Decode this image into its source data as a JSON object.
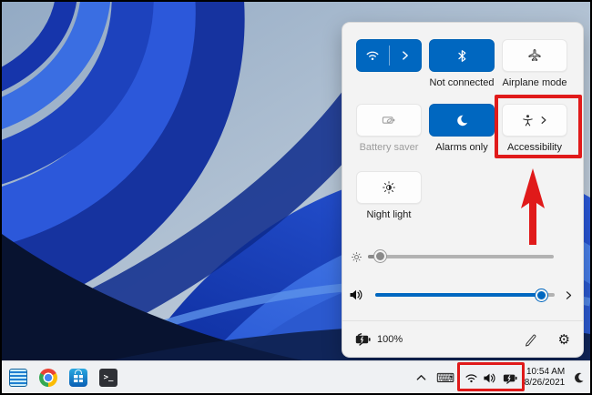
{
  "colors": {
    "accent_blue": "#0067c0",
    "annotation_red": "#e01a1a",
    "panel_bg": "#f3f3f3",
    "taskbar_bg": "#eff1f3"
  },
  "quick_settings": {
    "tiles": [
      {
        "name": "wifi",
        "label": "",
        "state": "on"
      },
      {
        "name": "bluetooth",
        "label": "Not connected",
        "state": "on"
      },
      {
        "name": "airplane-mode",
        "label": "Airplane mode",
        "state": "off"
      },
      {
        "name": "battery-saver",
        "label": "Battery saver",
        "state": "disabled"
      },
      {
        "name": "focus-assist",
        "label": "Alarms only",
        "state": "on"
      },
      {
        "name": "accessibility",
        "label": "Accessibility",
        "state": "off"
      },
      {
        "name": "night-light",
        "label": "Night light",
        "state": "off"
      }
    ],
    "sliders": {
      "brightness": {
        "percent": 7
      },
      "volume": {
        "percent": 93
      }
    },
    "battery_percent": "100%"
  },
  "taskbar": {
    "apps": [
      "notes-app",
      "chrome",
      "microsoft-store",
      "terminal"
    ],
    "terminal_glyph": ">_"
  },
  "tray": {
    "time": "10:54 AM",
    "date": "8/26/2021",
    "keyboard_glyph": "⌨",
    "settings_glyph": "⚙"
  }
}
